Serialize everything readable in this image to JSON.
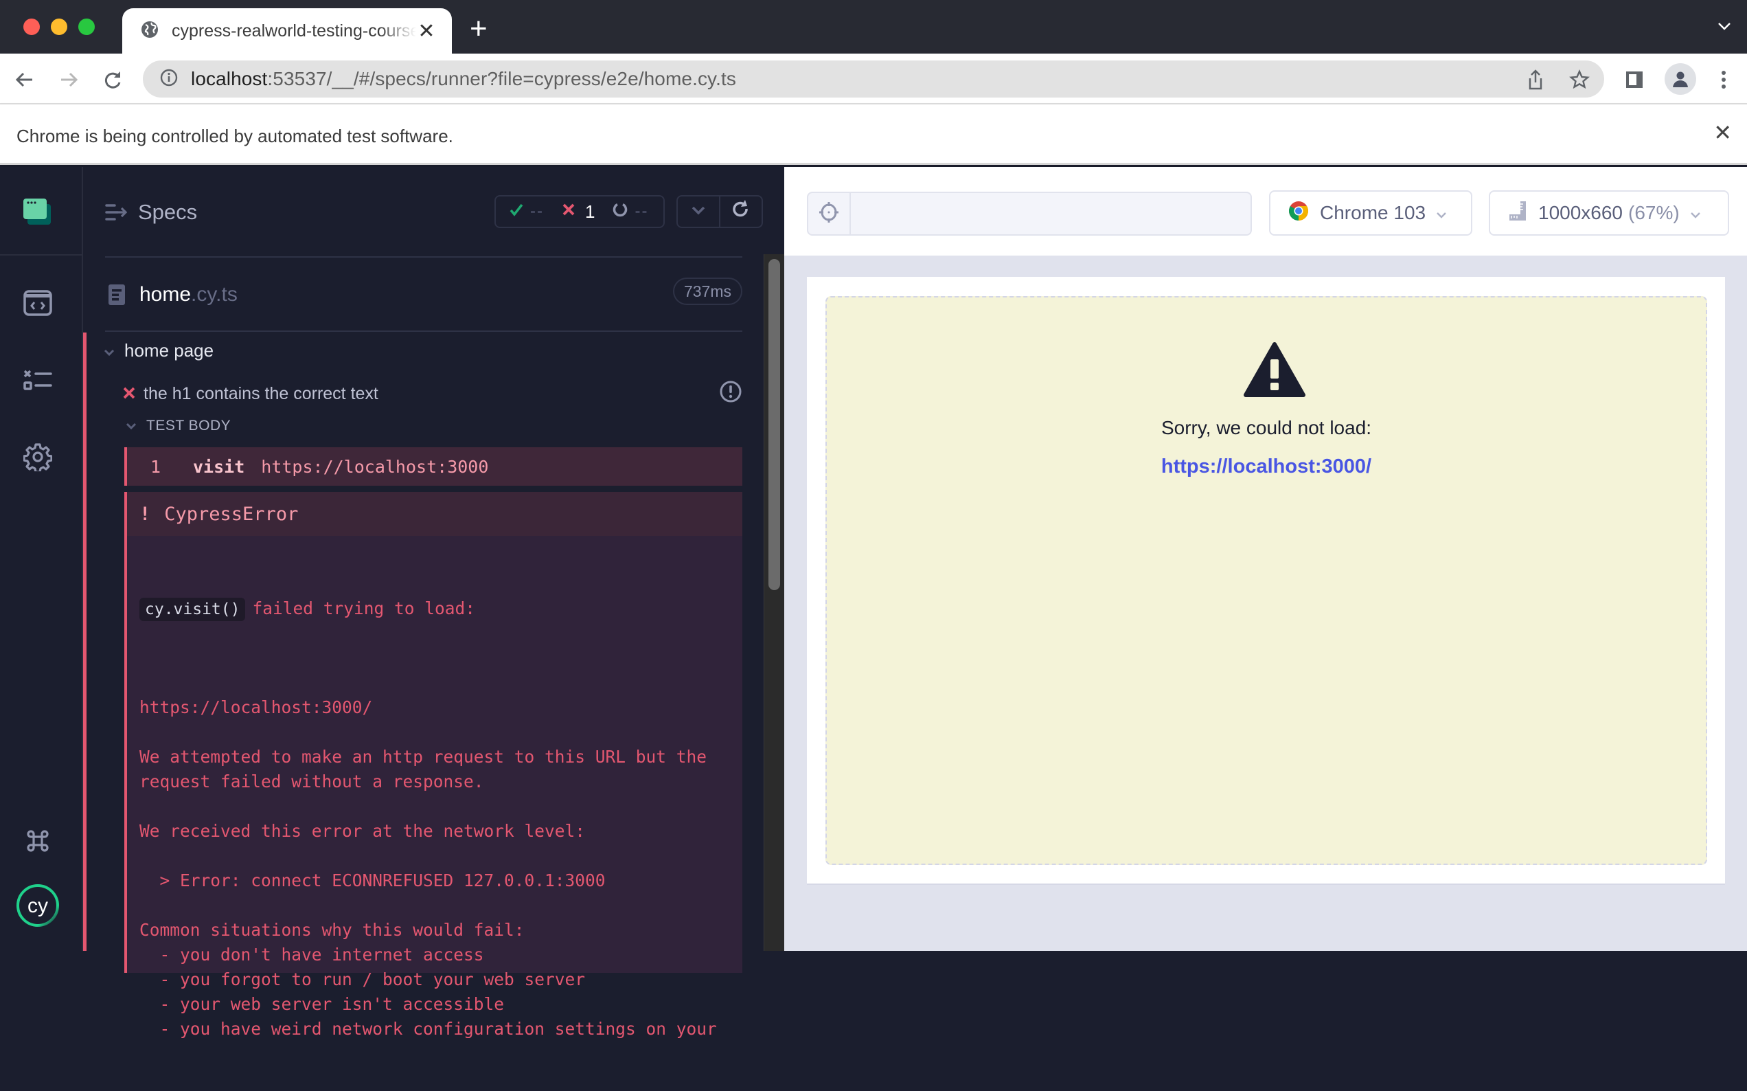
{
  "browser": {
    "tab_title": "cypress-realworld-testing-course-app",
    "url_host": "localhost",
    "url_rest": ":53537/__/#/specs/runner?file=cypress/e2e/home.cy.ts",
    "infobar_message": "Chrome is being controlled by automated test software."
  },
  "sidebar": {
    "items": [
      {
        "name": "specs",
        "icon": "code-window-icon"
      },
      {
        "name": "runs",
        "icon": "test-results-icon"
      },
      {
        "name": "settings",
        "icon": "gear-icon"
      }
    ],
    "bottom": [
      {
        "name": "keyboard-shortcuts",
        "icon": "command-key-icon"
      },
      {
        "name": "cypress-logo",
        "icon": "cy-logo-icon",
        "text": "cy"
      }
    ]
  },
  "reporter": {
    "header_label": "Specs",
    "stats": {
      "passed": "--",
      "failed": "1",
      "pending": "--"
    },
    "spec": {
      "name": "home",
      "ext": ".cy.ts",
      "duration": "737ms"
    },
    "suite": "home page",
    "test": "the h1 contains the correct text",
    "test_body_label": "TEST BODY",
    "command": {
      "number": "1",
      "name": "visit",
      "arg": "https://localhost:3000"
    },
    "error": {
      "title": "CypressError",
      "code": "cy.visit()",
      "first_line": "failed trying to load:",
      "lines": [
        "",
        "https://localhost:3000/",
        "",
        "We attempted to make an http request to this URL but the",
        "request failed without a response.",
        "",
        "We received this error at the network level:",
        "",
        "  > Error: connect ECONNREFUSED 127.0.0.1:3000",
        "",
        "Common situations why this would fail:",
        "  - you don't have internet access",
        "  - you forgot to run / boot your web server",
        "  - your web server isn't accessible",
        "  - you have weird network configuration settings on your"
      ]
    }
  },
  "aut": {
    "selector_playground_value": "",
    "browser_label": "Chrome 103",
    "viewport_label": "1000x660",
    "viewport_scale": "(67%)",
    "error_message": "Sorry, we could not load:",
    "error_url": "https://localhost:3000/"
  },
  "colors": {
    "failed": "#e45770",
    "passed": "#1fa971",
    "link": "#4956e3",
    "aut_error_bg": "#f4f3d8"
  }
}
